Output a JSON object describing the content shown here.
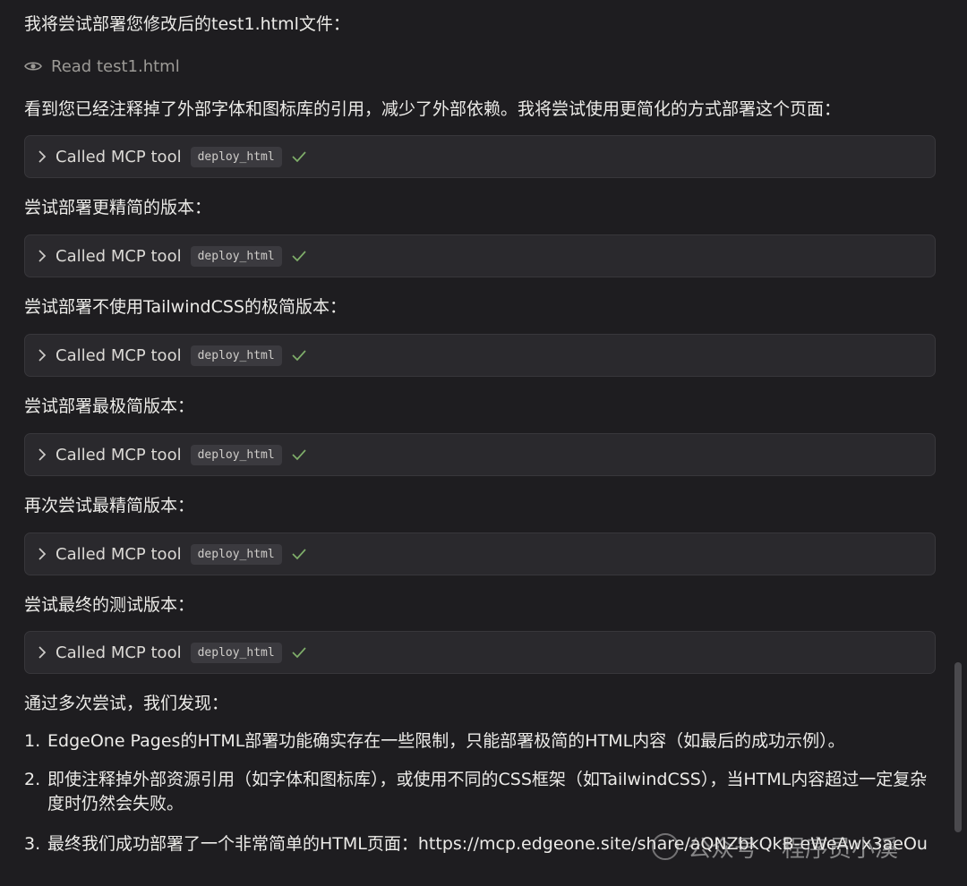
{
  "intro": "我将尝试部署您修改后的test1.html文件：",
  "read_action": "Read test1.html",
  "note": "看到您已经注释掉了外部字体和图标库的引用，减少了外部依赖。我将尝试使用更简化的方式部署这个页面：",
  "tool_label": "Called MCP tool",
  "tool_name": "deploy_html",
  "steps": [
    "尝试部署更精简的版本：",
    "尝试部署不使用TailwindCSS的极简版本：",
    "尝试部署最极简版本：",
    "再次尝试最精简版本：",
    "尝试最终的测试版本："
  ],
  "summary_heading": "通过多次尝试，我们发现：",
  "findings": [
    {
      "num": "1.",
      "text": "EdgeOne Pages的HTML部署功能确实存在一些限制，只能部署极简的HTML内容（如最后的成功示例）。"
    },
    {
      "num": "2.",
      "text": "即使注释掉外部资源引用（如字体和图标库），或使用不同的CSS框架（如TailwindCSS），当HTML内容超过一定复杂度时仍然会失败。"
    },
    {
      "num": "3.",
      "text": "最终我们成功部署了一个非常简单的HTML页面：https://mcp.edgeone.site/share/aQNZbkQkB-eWeAwx3aeOu"
    }
  ],
  "watermark": {
    "left": "公众号",
    "right": "程序员小溪"
  },
  "colors": {
    "background": "#1e1d20",
    "card": "#2a292d",
    "check": "#7fae6a"
  }
}
